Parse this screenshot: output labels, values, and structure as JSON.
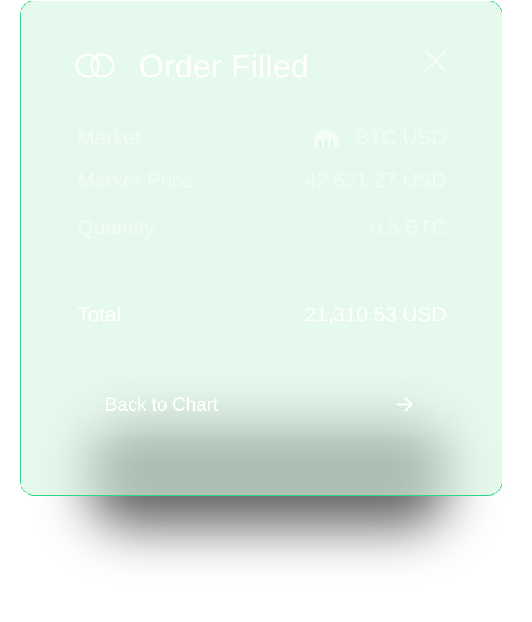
{
  "dialog": {
    "title": "Order Filled",
    "logo_icon": "two-rings-logo-icon",
    "close_icon": "close-icon"
  },
  "details": [
    {
      "label": "Market",
      "value": "BTC USD",
      "icon": "kraken-market-icon"
    },
    {
      "label": "Market Price",
      "value": "42,621.27 USD"
    },
    {
      "label": "Quantity",
      "value": "0.5 BTC"
    }
  ],
  "total": {
    "label": "Total",
    "value": "21,310.53 USD"
  },
  "action": {
    "label": "Back to Chart",
    "icon": "arrow-right-icon"
  },
  "colors": {
    "card_border": "#2fd68a",
    "card_fill": "#d5f6e2",
    "text": "#ffffff"
  }
}
